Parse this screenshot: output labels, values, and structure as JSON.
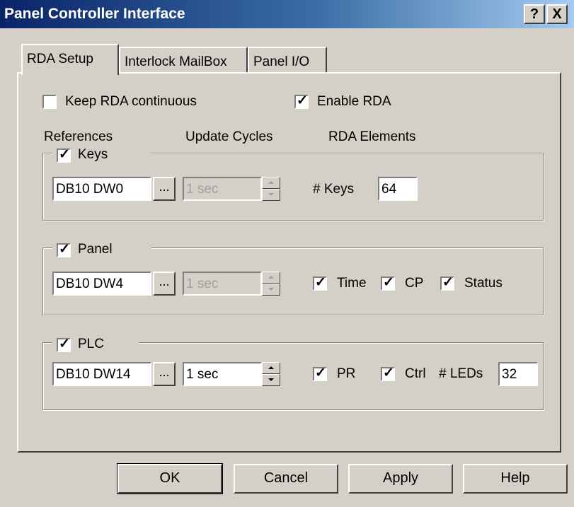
{
  "window": {
    "title": "Panel Controller Interface",
    "help_glyph": "?",
    "close_glyph": "X"
  },
  "tabs": [
    {
      "label": "RDA Setup",
      "active": true
    },
    {
      "label": "Interlock MailBox",
      "active": false
    },
    {
      "label": "Panel I/O",
      "active": false
    }
  ],
  "options": {
    "keep_rda_label": "Keep RDA continuous",
    "keep_rda_checked": false,
    "enable_rda_label": "Enable RDA",
    "enable_rda_checked": true
  },
  "headers": {
    "references": "References",
    "update_cycles": "Update Cycles",
    "rda_elements": "RDA Elements"
  },
  "keys_group": {
    "label": "Keys",
    "checked": true,
    "reference": "DB10 DW0",
    "browse": "...",
    "cycle": "1 sec",
    "cycle_enabled": false,
    "count_label": "# Keys",
    "count_value": "64"
  },
  "panel_group": {
    "label": "Panel",
    "checked": true,
    "reference": "DB10 DW4",
    "browse": "...",
    "cycle": "1 sec",
    "cycle_enabled": false,
    "time_label": "Time",
    "time_checked": true,
    "cp_label": "CP",
    "cp_checked": true,
    "status_label": "Status",
    "status_checked": true
  },
  "plc_group": {
    "label": "PLC",
    "checked": true,
    "reference": "DB10 DW14",
    "browse": "...",
    "cycle": "1 sec",
    "cycle_enabled": true,
    "pr_label": "PR",
    "pr_checked": true,
    "ctrl_label": "Ctrl",
    "ctrl_checked": true,
    "leds_label": "# LEDs",
    "leds_value": "32"
  },
  "buttons": {
    "ok": "OK",
    "cancel": "Cancel",
    "apply": "Apply",
    "help": "Help"
  }
}
